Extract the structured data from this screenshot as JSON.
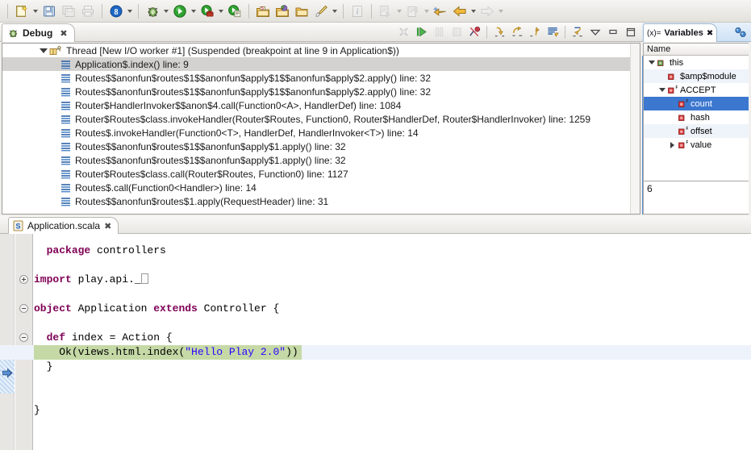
{
  "toolbar": {
    "groups": [
      {
        "items": [
          {
            "name": "new-wizard-icon",
            "arrow": true,
            "enabled": true
          },
          {
            "name": "save-icon",
            "arrow": false,
            "enabled": true
          },
          {
            "name": "save-all-icon",
            "arrow": false,
            "enabled": false
          },
          {
            "name": "print-icon",
            "arrow": false,
            "enabled": false
          }
        ]
      },
      {
        "items": [
          {
            "name": "scala-search-icon",
            "arrow": true,
            "enabled": true
          }
        ]
      },
      {
        "items": [
          {
            "name": "debug-icon",
            "arrow": true,
            "enabled": true
          },
          {
            "name": "run-icon",
            "arrow": true,
            "enabled": true
          },
          {
            "name": "run-external-tools-icon",
            "arrow": true,
            "enabled": true
          },
          {
            "name": "run-last-launched-icon",
            "arrow": false,
            "enabled": true
          }
        ]
      },
      {
        "items": [
          {
            "name": "new-scala-project-icon",
            "arrow": false,
            "enabled": true
          },
          {
            "name": "new-scala-package-icon",
            "arrow": false,
            "enabled": true
          },
          {
            "name": "new-scala-folder-icon",
            "arrow": false,
            "enabled": true
          },
          {
            "name": "new-scala-class-icon",
            "arrow": true,
            "enabled": true
          }
        ]
      },
      {
        "items": [
          {
            "name": "info-icon",
            "arrow": false,
            "enabled": false
          }
        ]
      },
      {
        "items": [
          {
            "name": "next-annotation-icon",
            "arrow": true,
            "enabled": false
          },
          {
            "name": "previous-annotation-icon",
            "arrow": true,
            "enabled": false
          },
          {
            "name": "last-edit-location-icon",
            "arrow": false,
            "enabled": true
          },
          {
            "name": "back-navigation-icon",
            "arrow": true,
            "enabled": true
          },
          {
            "name": "forward-navigation-icon",
            "arrow": true,
            "enabled": false
          }
        ]
      }
    ]
  },
  "debug_view": {
    "tab_label": "Debug",
    "close_glyph": "✖",
    "toolbar": [
      {
        "name": "disconnect-button",
        "enabled": false
      },
      {
        "name": "resume-button",
        "enabled": true
      },
      {
        "name": "suspend-button",
        "enabled": false
      },
      {
        "name": "terminate-button",
        "enabled": false
      },
      {
        "name": "skip-all-breakpoints-button",
        "enabled": true
      },
      {
        "name": "step-into-button",
        "enabled": true
      },
      {
        "name": "step-over-button",
        "enabled": true
      },
      {
        "name": "step-return-button",
        "enabled": true
      },
      {
        "name": "use-step-filters-button",
        "enabled": true
      },
      {
        "name": "drop-to-frame-button",
        "enabled": true
      },
      {
        "name": "view-menu-button",
        "enabled": true
      },
      {
        "name": "minimize-button",
        "enabled": true
      },
      {
        "name": "maximize-button",
        "enabled": true
      }
    ],
    "thread": {
      "label": "Thread [New I/O  worker #1] (Suspended (breakpoint at line 9 in Application$))",
      "expanded": true
    },
    "frames": [
      {
        "label": "Application$.index() line: 9",
        "selected": true
      },
      {
        "label": "Routes$$anonfun$routes$1$$anonfun$apply$1$$anonfun$apply$2.apply() line: 32",
        "selected": false
      },
      {
        "label": "Routes$$anonfun$routes$1$$anonfun$apply$1$$anonfun$apply$2.apply() line: 32",
        "selected": false
      },
      {
        "label": "Router$HandlerInvoker$$anon$4.call(Function0<A>, HandlerDef) line: 1084",
        "selected": false
      },
      {
        "label": "Router$Routes$class.invokeHandler(Router$Routes, Function0, Router$HandlerDef, Router$HandlerInvoker) line: 1259",
        "selected": false
      },
      {
        "label": "Routes$.invokeHandler(Function0<T>, HandlerDef, HandlerInvoker<T>) line: 14",
        "selected": false
      },
      {
        "label": "Routes$$anonfun$routes$1$$anonfun$apply$1.apply() line: 32",
        "selected": false
      },
      {
        "label": "Routes$$anonfun$routes$1$$anonfun$apply$1.apply() line: 32",
        "selected": false
      },
      {
        "label": "Router$Routes$class.call(Router$Routes, Function0) line: 1127",
        "selected": false
      },
      {
        "label": "Routes$.call(Function0<Handler>) line: 14",
        "selected": false
      },
      {
        "label": "Routes$$anonfun$routes$1.apply(RequestHeader) line: 31",
        "selected": false
      }
    ]
  },
  "variables_view": {
    "tab_label": "Variables",
    "tab_prefix": "(x)=",
    "close_glyph": "✖",
    "toolbar": [
      {
        "name": "show-logical-structure-button"
      },
      {
        "name": "collapse-all-button"
      }
    ],
    "column_header": "Name",
    "rows": [
      {
        "label": "this",
        "indent": 0,
        "twisty": "open",
        "icon": "object-instance-icon",
        "icon_color": "#3fa13f",
        "final": false,
        "selected": false
      },
      {
        "label": "$amp$module",
        "indent": 1,
        "twisty": "none",
        "icon": "field-private-icon",
        "icon_color": "#d43a3a",
        "final": false,
        "selected": false
      },
      {
        "label": "ACCEPT",
        "indent": 1,
        "twisty": "open",
        "icon": "field-private-icon",
        "icon_color": "#d43a3a",
        "final": true,
        "selected": false
      },
      {
        "label": "count",
        "indent": 2,
        "twisty": "none",
        "icon": "field-private-icon",
        "icon_color": "#d43a3a",
        "final": true,
        "selected": true
      },
      {
        "label": "hash",
        "indent": 2,
        "twisty": "none",
        "icon": "field-private-icon",
        "icon_color": "#d43a3a",
        "final": false,
        "selected": false
      },
      {
        "label": "offset",
        "indent": 2,
        "twisty": "none",
        "icon": "field-private-icon",
        "icon_color": "#d43a3a",
        "final": true,
        "selected": false
      },
      {
        "label": "value",
        "indent": 2,
        "twisty": "closed",
        "icon": "field-private-icon",
        "icon_color": "#d43a3a",
        "final": true,
        "selected": false
      }
    ],
    "detail_value": "6"
  },
  "editor": {
    "tab_label": "Application.scala",
    "tab_icon": "scala-file-icon",
    "close_glyph": "✖",
    "code_lines": [
      {
        "indent": 1,
        "fold": "none",
        "exec": false,
        "tokens": [
          {
            "t": "kw",
            "v": "package"
          },
          {
            "t": "p",
            "v": " controllers"
          }
        ]
      },
      {
        "indent": 0,
        "fold": "none",
        "exec": false,
        "tokens": []
      },
      {
        "indent": 0,
        "fold": "plus",
        "exec": false,
        "tokens": [
          {
            "t": "kw",
            "v": "import"
          },
          {
            "t": "p",
            "v": " play.api._"
          },
          {
            "t": "cursor",
            "v": ""
          }
        ]
      },
      {
        "indent": 0,
        "fold": "none",
        "exec": false,
        "tokens": []
      },
      {
        "indent": 0,
        "fold": "minus",
        "exec": false,
        "tokens": [
          {
            "t": "kw",
            "v": "object"
          },
          {
            "t": "p",
            "v": " Application "
          },
          {
            "t": "kw",
            "v": "extends"
          },
          {
            "t": "p",
            "v": " Controller {"
          }
        ]
      },
      {
        "indent": 0,
        "fold": "none",
        "exec": false,
        "tokens": []
      },
      {
        "indent": 1,
        "fold": "minus",
        "exec": false,
        "tokens": [
          {
            "t": "kw",
            "v": "def"
          },
          {
            "t": "p",
            "v": " index = Action {"
          }
        ]
      },
      {
        "indent": 2,
        "fold": "none",
        "exec": true,
        "tokens": [
          {
            "t": "p",
            "v": "Ok(views.html.index("
          },
          {
            "t": "str",
            "v": "\"Hello Play 2.0\""
          },
          {
            "t": "p",
            "v": "))"
          }
        ]
      },
      {
        "indent": 1,
        "fold": "none",
        "exec": false,
        "tokens": [
          {
            "t": "p",
            "v": "}"
          }
        ]
      },
      {
        "indent": 0,
        "fold": "none",
        "exec": false,
        "tokens": []
      },
      {
        "indent": 0,
        "fold": "none",
        "exec": false,
        "tokens": []
      },
      {
        "indent": 0,
        "fold": "none",
        "exec": false,
        "tokens": [
          {
            "t": "p",
            "v": "}"
          }
        ]
      }
    ],
    "exec_marker": "debug-current-instruction-pointer"
  },
  "colors": {
    "keyword": "#7f0055",
    "string": "#2a00ff",
    "exec_line_highlight": "#c5d9a6",
    "selection": "#3c77d0",
    "stack_selected": "#d4d2cf"
  }
}
